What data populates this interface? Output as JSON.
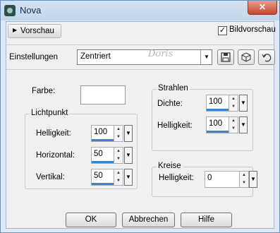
{
  "window": {
    "title": "Nova",
    "close_label": "✕"
  },
  "preview": {
    "toggle_label": "Vorschau",
    "checkbox_label": "Bildvorschau",
    "checkbox_checked": true
  },
  "settings": {
    "label": "Einstellungen",
    "value": "Zentriert",
    "watermark": "Doris"
  },
  "color": {
    "label": "Farbe:",
    "value": "#ffffff"
  },
  "lightpoint": {
    "title": "Lichtpunkt",
    "fields": [
      {
        "label": "Helligkeit:",
        "value": "100"
      },
      {
        "label": "Horizontal:",
        "value": "50"
      },
      {
        "label": "Vertikal:",
        "value": "50"
      }
    ]
  },
  "rays": {
    "title": "Strahlen",
    "fields": [
      {
        "label": "Dichte:",
        "value": "100"
      },
      {
        "label": "Helligkeit:",
        "value": "100"
      }
    ]
  },
  "circles": {
    "title": "Kreise",
    "fields": [
      {
        "label": "Helligkeit:",
        "value": "0"
      }
    ]
  },
  "buttons": {
    "ok": "OK",
    "cancel": "Abbrechen",
    "help": "Hilfe"
  },
  "colors": {
    "accent": "#3b82d0",
    "titlebar": "#c8d9ed",
    "dialog": "#f0f0f0"
  },
  "icons": [
    "app-icon",
    "play-icon",
    "save-icon",
    "cube-icon",
    "reset-icon"
  ]
}
